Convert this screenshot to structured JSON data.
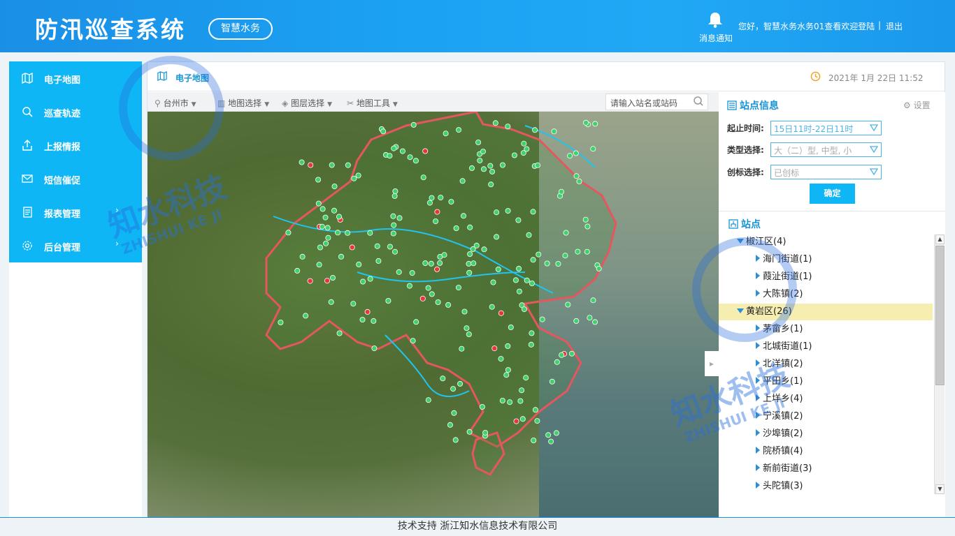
{
  "header": {
    "app_title": "防汛巡查系统",
    "badge": "智慧水务",
    "notify_label": "消息通知",
    "welcome": "您好，智慧水务水务01查看欢迎登陆",
    "separator": "|",
    "logout": "退出"
  },
  "sidebar": {
    "items": [
      {
        "label": "电子地图",
        "icon": "map-icon"
      },
      {
        "label": "巡查轨迹",
        "icon": "track-icon"
      },
      {
        "label": "上报情报",
        "icon": "upload-icon"
      },
      {
        "label": "短信催促",
        "icon": "mail-icon"
      },
      {
        "label": "报表管理",
        "icon": "report-icon",
        "arrow": "›"
      },
      {
        "label": "后台管理",
        "icon": "settings-icon",
        "arrow": "›"
      }
    ]
  },
  "main": {
    "title": "电子地图",
    "datetime": "2021年 1月 22日 11:52"
  },
  "toolbar": {
    "city": "台州市",
    "map_select": "地图选择",
    "layer_select": "图层选择",
    "map_tools": "地图工具",
    "search_placeholder": "请输入站名或站码"
  },
  "station_info": {
    "title": "站点信息",
    "settings": "设置",
    "time_label": "起止时间:",
    "time_value": "15日11时-22日11时",
    "type_label": "类型选择:",
    "type_value": "大（二）型, 中型, 小",
    "flag_label": "创标选择:",
    "flag_value": "已创标",
    "ok_button": "确定"
  },
  "stations": {
    "title": "站点",
    "tree": [
      {
        "label": "椒江区(4)",
        "level": 0,
        "expanded": true
      },
      {
        "label": "海门街道(1)",
        "level": 1
      },
      {
        "label": "葭沚街道(1)",
        "level": 1
      },
      {
        "label": "大陈镇(2)",
        "level": 1
      },
      {
        "label": "黄岩区(26)",
        "level": 0,
        "expanded": true,
        "selected": true
      },
      {
        "label": "茅畲乡(1)",
        "level": 1
      },
      {
        "label": "北城街道(1)",
        "level": 1
      },
      {
        "label": "北洋镇(2)",
        "level": 1
      },
      {
        "label": "平田乡(1)",
        "level": 1
      },
      {
        "label": "上垟乡(4)",
        "level": 1
      },
      {
        "label": "宁溪镇(2)",
        "level": 1
      },
      {
        "label": "沙埠镇(2)",
        "level": 1
      },
      {
        "label": "院桥镇(4)",
        "level": 1
      },
      {
        "label": "新前街道(3)",
        "level": 1
      },
      {
        "label": "头陀镇(3)",
        "level": 1
      }
    ]
  },
  "footer": {
    "text": "技术支持 浙江知水信息技术有限公司"
  },
  "watermark": {
    "cn": "知水科技",
    "en": "ZHISHUI KE JI"
  },
  "colors": {
    "header_blue": "#1ba1f2",
    "sidebar_blue": "#0eb6f5",
    "accent_text": "#1593d8",
    "boundary_red": "#e4575e",
    "river_cyan": "#1fc5f0",
    "station_green": "#3fd26a",
    "station_red": "#e8343a"
  }
}
